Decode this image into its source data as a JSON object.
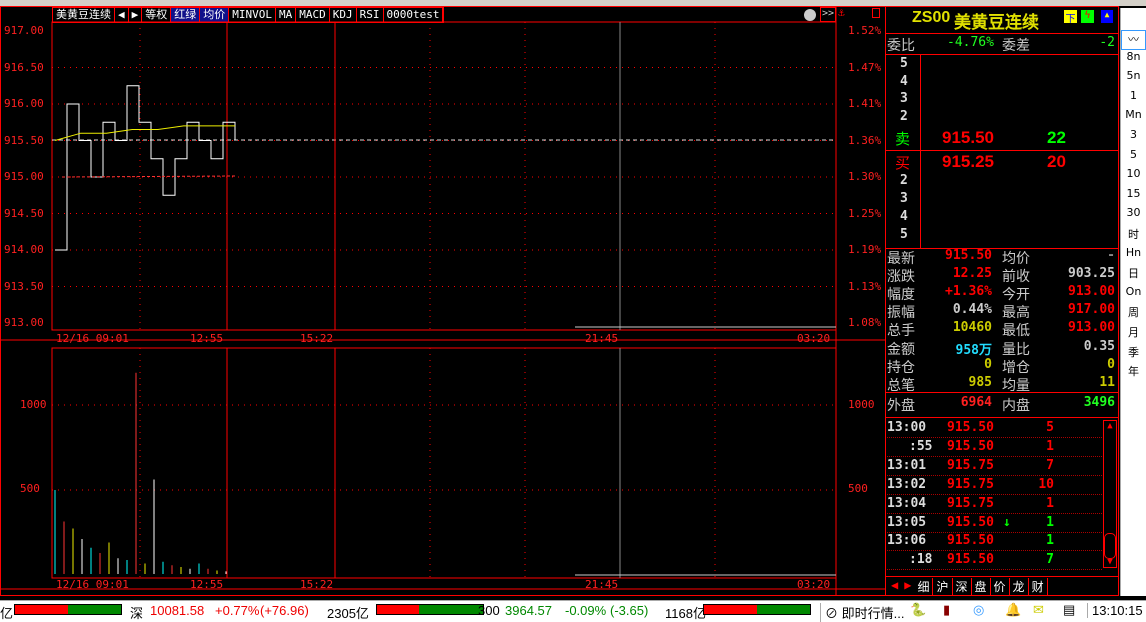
{
  "toolbar": {
    "title": "美黄豆连续",
    "items": [
      "等权",
      "红绿",
      "均价",
      "MINVOL",
      "MA",
      "MACD",
      "KDJ",
      "RSI",
      "0000test"
    ]
  },
  "price_axis": [
    "917.00",
    "916.50",
    "916.00",
    "915.50",
    "915.00",
    "914.50",
    "914.00",
    "913.50",
    "913.00"
  ],
  "pct_axis": [
    "1.52%",
    "1.47%",
    "1.41%",
    "1.36%",
    "1.30%",
    "1.25%",
    "1.19%",
    "1.13%",
    "1.08%"
  ],
  "time_axis": [
    "12/16 09:01",
    "12:55",
    "15:22",
    "21:45",
    "03:20"
  ],
  "vol_axis": [
    "1000",
    "500"
  ],
  "chart_data": {
    "type": "line",
    "price": [
      914.0,
      916.0,
      915.5,
      915.0,
      915.75,
      915.5,
      916.25,
      915.75,
      915.25,
      914.75,
      915.25,
      915.75,
      915.5,
      915.25,
      915.75,
      915.5
    ],
    "avg": [
      915.5,
      915.6,
      915.6,
      915.65,
      915.65,
      915.7,
      915.7,
      915.7
    ],
    "volume": [
      480,
      300,
      260,
      200,
      150,
      120,
      180,
      90,
      80,
      1150,
      60,
      540,
      70,
      50,
      40,
      30,
      60,
      30,
      20,
      15
    ]
  },
  "quote": {
    "code": "ZS00",
    "name": "美黄豆连续",
    "wb_label": "委比",
    "wb": "-4.76%",
    "wc_label": "委差",
    "wc": "-2",
    "sell_levels": [
      "5",
      "4",
      "3",
      "2"
    ],
    "sell_label": "卖",
    "sell_price": "915.50",
    "sell_vol": "22",
    "buy_label": "买",
    "buy_price": "915.25",
    "buy_vol": "20",
    "buy_levels": [
      "2",
      "3",
      "4",
      "5"
    ],
    "stats": [
      [
        "最新",
        "915.50",
        "均价",
        "-"
      ],
      [
        "涨跌",
        "12.25",
        "前收",
        "903.25"
      ],
      [
        "幅度",
        "+1.36%",
        "今开",
        "913.00"
      ],
      [
        "振幅",
        "0.44%",
        "最高",
        "917.00"
      ],
      [
        "总手",
        "10460",
        "最低",
        "913.00"
      ],
      [
        "金额",
        "958万",
        "量比",
        "0.35"
      ],
      [
        "持仓",
        "0",
        "增仓",
        "0"
      ],
      [
        "总笔",
        "985",
        "均量",
        "11"
      ]
    ],
    "outer_label": "外盘",
    "outer": "6964",
    "inner_label": "内盘",
    "inner": "3496"
  },
  "ticks": [
    [
      "13:00",
      "915.50",
      "",
      "5"
    ],
    [
      ":55",
      "915.50",
      "",
      "1"
    ],
    [
      "13:01",
      "915.75",
      "",
      "7"
    ],
    [
      "13:02",
      "915.75",
      "",
      "10"
    ],
    [
      "13:04",
      "915.75",
      "",
      "1"
    ],
    [
      "13:05",
      "915.50",
      "↓",
      "1"
    ],
    [
      "13:06",
      "915.50",
      "",
      "1"
    ],
    [
      ":18",
      "915.50",
      "",
      "7"
    ]
  ],
  "tabs": [
    "细",
    "沪",
    "深",
    "盘",
    "价",
    "龙",
    "财"
  ],
  "sidebar": [
    "8n",
    "5n",
    "1",
    "Mn",
    "3",
    "5",
    "10",
    "15",
    "30",
    "时",
    "Hn",
    "日",
    "On",
    "周",
    "月",
    "季",
    "年"
  ],
  "status": {
    "left": "亿",
    "sz_label": "深",
    "sz_val": "10081.58",
    "sz_pct": "+0.77%",
    "sz_chg": "(+76.96)",
    "sz_amt": "2305亿",
    "hs_label": "300",
    "hs_val": "3964.57",
    "hs_pct": "-0.09%",
    "hs_chg": "(-3.65)",
    "hs_amt": "1168亿",
    "news": "即时行情...",
    "clock": "13:10:15"
  }
}
